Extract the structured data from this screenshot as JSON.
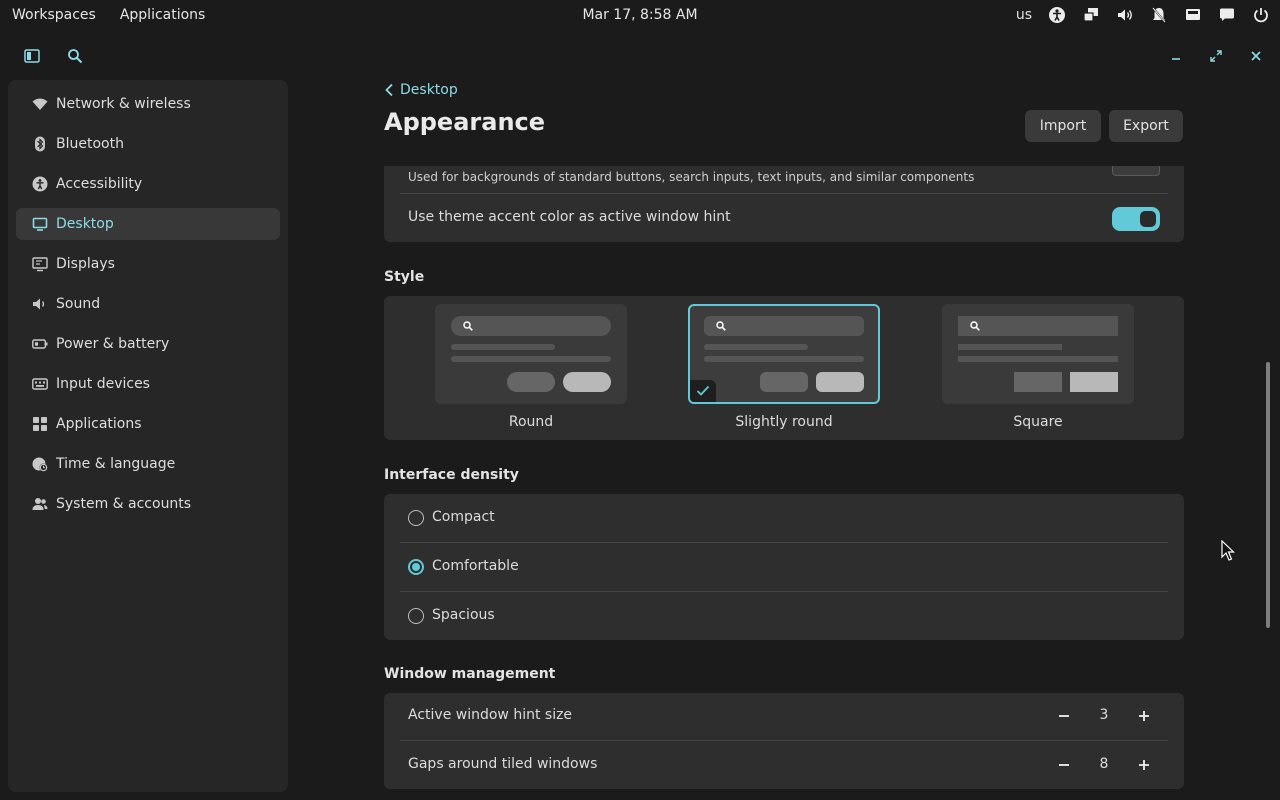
{
  "panel": {
    "workspaces": "Workspaces",
    "applications": "Applications",
    "clock": "Mar 17, 8:58 AM",
    "keyboard_layout": "us",
    "tray_icons": [
      "accessibility-icon",
      "network-wired-icon",
      "volume-icon",
      "notifications-off-icon",
      "display-icon",
      "chat-icon",
      "power-icon"
    ]
  },
  "sidebar": {
    "items": [
      {
        "label": "Network & wireless",
        "icon": "wifi-icon"
      },
      {
        "label": "Bluetooth",
        "icon": "bluetooth-icon"
      },
      {
        "label": "Accessibility",
        "icon": "accessibility-icon"
      },
      {
        "label": "Desktop",
        "icon": "desktop-icon",
        "active": true
      },
      {
        "label": "Displays",
        "icon": "display-icon"
      },
      {
        "label": "Sound",
        "icon": "volume-icon"
      },
      {
        "label": "Power & battery",
        "icon": "battery-icon"
      },
      {
        "label": "Input devices",
        "icon": "keyboard-icon"
      },
      {
        "label": "Applications",
        "icon": "apps-grid-icon"
      },
      {
        "label": "Time & language",
        "icon": "globe-clock-icon"
      },
      {
        "label": "System & accounts",
        "icon": "users-icon"
      }
    ]
  },
  "header": {
    "back_label": "Desktop",
    "title": "Appearance",
    "import_label": "Import",
    "export_label": "Export"
  },
  "colors_card": {
    "interface_text_sub": "Used for backgrounds of standard buttons, search inputs, text inputs, and similar components",
    "accent_hint_label": "Use theme accent color as active window hint",
    "accent_hint_on": true
  },
  "style": {
    "title": "Style",
    "options": [
      {
        "label": "Round",
        "selected": false
      },
      {
        "label": "Slightly round",
        "selected": true
      },
      {
        "label": "Square",
        "selected": false
      }
    ]
  },
  "density": {
    "title": "Interface density",
    "options": [
      {
        "label": "Compact",
        "selected": false
      },
      {
        "label": "Comfortable",
        "selected": true
      },
      {
        "label": "Spacious",
        "selected": false
      }
    ]
  },
  "window_management": {
    "title": "Window management",
    "hint_size_label": "Active window hint size",
    "hint_size_value": "3",
    "gaps_label": "Gaps around tiled windows",
    "gaps_value": "8"
  },
  "colors": {
    "accent": "#62c9d8",
    "accent_text": "#8ddbe6",
    "background": "#1b1b1b",
    "card": "#2e2e2e"
  }
}
